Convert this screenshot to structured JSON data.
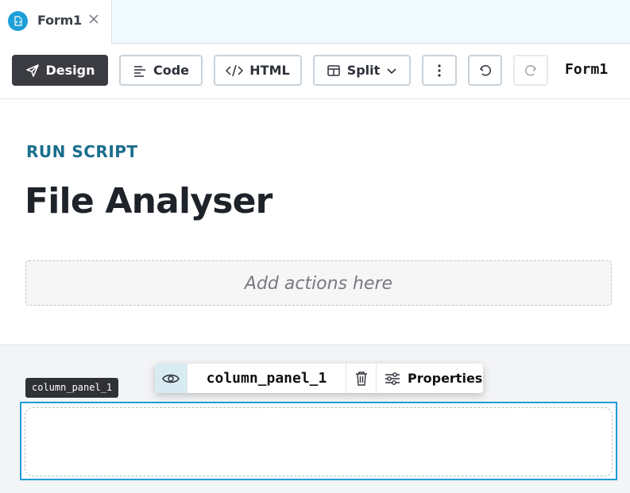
{
  "tab": {
    "label": "Form1",
    "icon": "form-file-icon",
    "close_icon": "close-icon"
  },
  "toolbar": {
    "design_label": "Design",
    "code_label": "Code",
    "html_label": "HTML",
    "split_label": "Split",
    "more_icon": "more-vertical-icon",
    "undo_icon": "undo-icon",
    "redo_icon": "redo-icon",
    "form_name": "Form1"
  },
  "header": {
    "subtitle": "RUN SCRIPT",
    "title": "File Analyser",
    "actions_placeholder": "Add actions here"
  },
  "component": {
    "tag_label": "column_panel_1",
    "name": "column_panel_1",
    "properties_label": "Properties",
    "visibility_icon": "eye-icon",
    "delete_icon": "trash-icon",
    "properties_icon": "sliders-icon"
  },
  "colors": {
    "accent": "#1f9bd8",
    "subtitle": "#1a6e8c",
    "primary_button": "#3a3c42"
  }
}
